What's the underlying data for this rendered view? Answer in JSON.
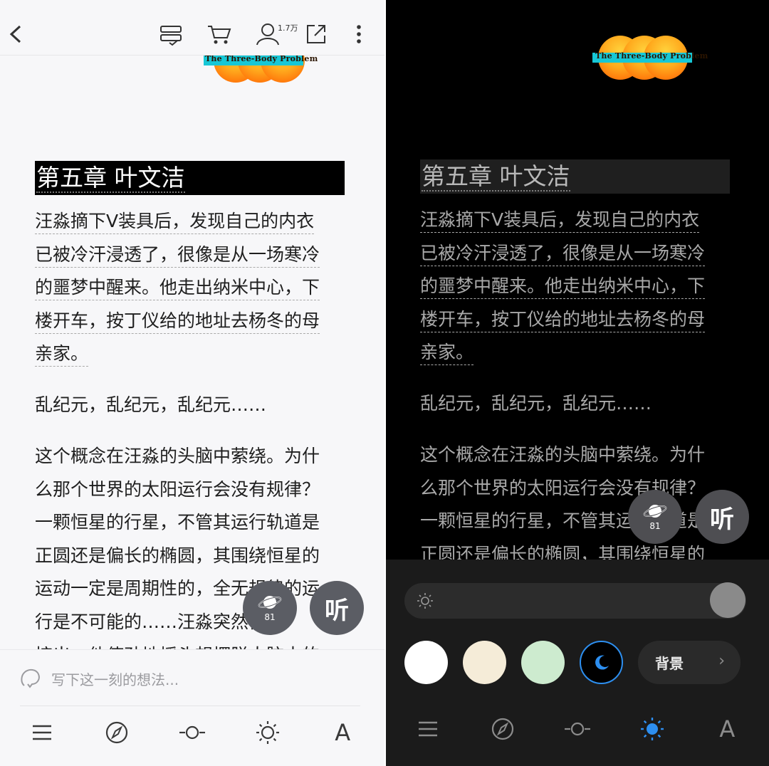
{
  "logo": {
    "text": "The Three-Body Problem"
  },
  "header": {
    "fans_count": "1.7万"
  },
  "chapter": {
    "title": "第五章 叶文洁",
    "paragraphs": [
      "汪淼摘下V装具后，发现自己的内衣\n已被冷汗浸透了，很像是从一场寒冷\n的噩梦中醒来。他走出纳米中心，下\n楼开车，按丁仪给的地址去杨冬的母\n亲家。",
      "乱纪元，乱纪元，乱纪元……",
      "这个概念在汪淼的头脑中萦绕。为什\n么那个世界的太阳运行会没有规律？\n一颗恒星的行星，不管其运行轨道是\n正圆还是偏长的椭圆，其围绕恒星的\n运动一定是周期性的，全无规律的运\n行是不可能的……汪淼突然自己\n惊出，他使劲地摇头想摆脱大脑中的"
    ]
  },
  "floating": {
    "planet_count": "81",
    "listen_label": "听"
  },
  "comment": {
    "placeholder": "写下这一刻的想法..."
  },
  "settings": {
    "background_label": "背景",
    "background_chevron": "›",
    "swatches": [
      "#ffffff",
      "#f5ecd8",
      "#cdebcf",
      "#000000"
    ],
    "accent_color": "#2d8ff0"
  },
  "toolbar": {
    "font_label": "A"
  }
}
